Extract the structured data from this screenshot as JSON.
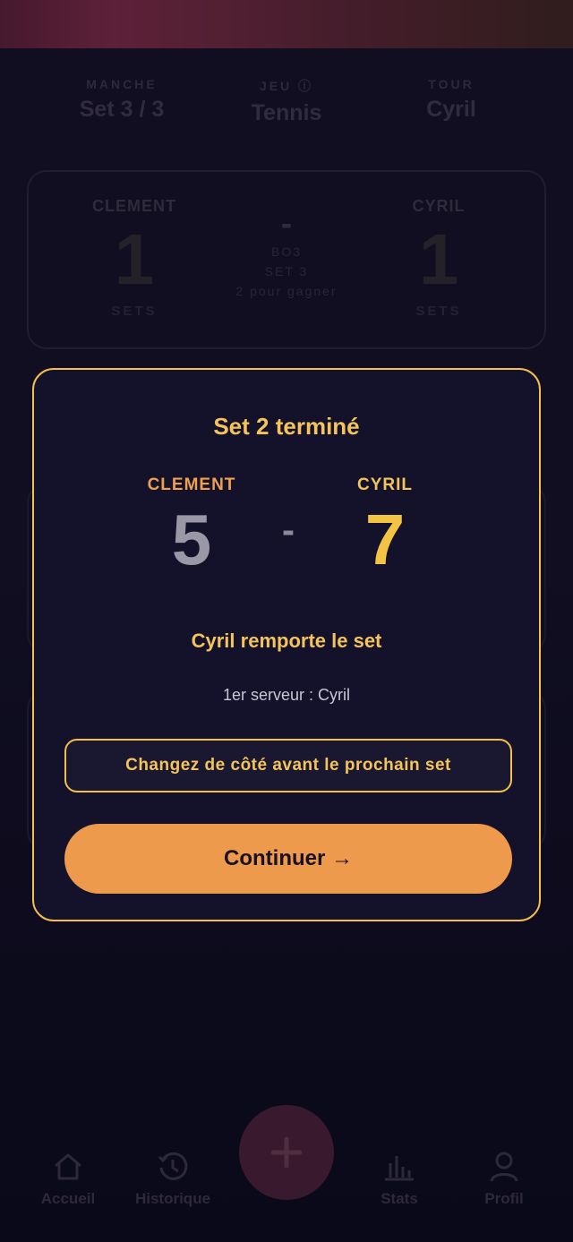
{
  "header": {
    "round": {
      "label": "MANCHE",
      "value": "Set 3 / 3"
    },
    "game": {
      "label": "JEU ⓘ",
      "value": "Tennis"
    },
    "turn": {
      "label": "TOUR",
      "value": "Cyril"
    }
  },
  "scoreboard": {
    "player1": {
      "name": "CLEMENT",
      "score": "1",
      "unit": "SETS"
    },
    "player2": {
      "name": "CYRIL",
      "score": "1",
      "unit": "SETS"
    },
    "center": {
      "dash": "-",
      "format": "BO3",
      "set": "SET 3",
      "to_win": "2 pour gagner"
    }
  },
  "modal": {
    "title": "Set 2 terminé",
    "player1": {
      "name": "CLEMENT",
      "score": "5"
    },
    "player2": {
      "name": "CYRIL",
      "score": "7"
    },
    "dash": "-",
    "winner_text": "Cyril remporte le set",
    "server_text": "1er serveur : Cyril",
    "side_change_text": "Changez de côté avant le prochain set",
    "continue_label": "Continuer →"
  },
  "nav": {
    "items": [
      {
        "label": "Accueil",
        "icon": "home-icon"
      },
      {
        "label": "Historique",
        "icon": "history-icon"
      },
      {
        "label": "Stats",
        "icon": "stats-icon"
      },
      {
        "label": "Profil",
        "icon": "profile-icon"
      }
    ],
    "fab_icon": "plus-icon"
  },
  "colors": {
    "accent_gold": "#f4c35a",
    "accent_orange": "#ee9a4c",
    "clement_name": "#f0a04f",
    "clement_score": "#9a97a6",
    "cyril_score": "#f3c443",
    "background": "#0d0b1f"
  }
}
